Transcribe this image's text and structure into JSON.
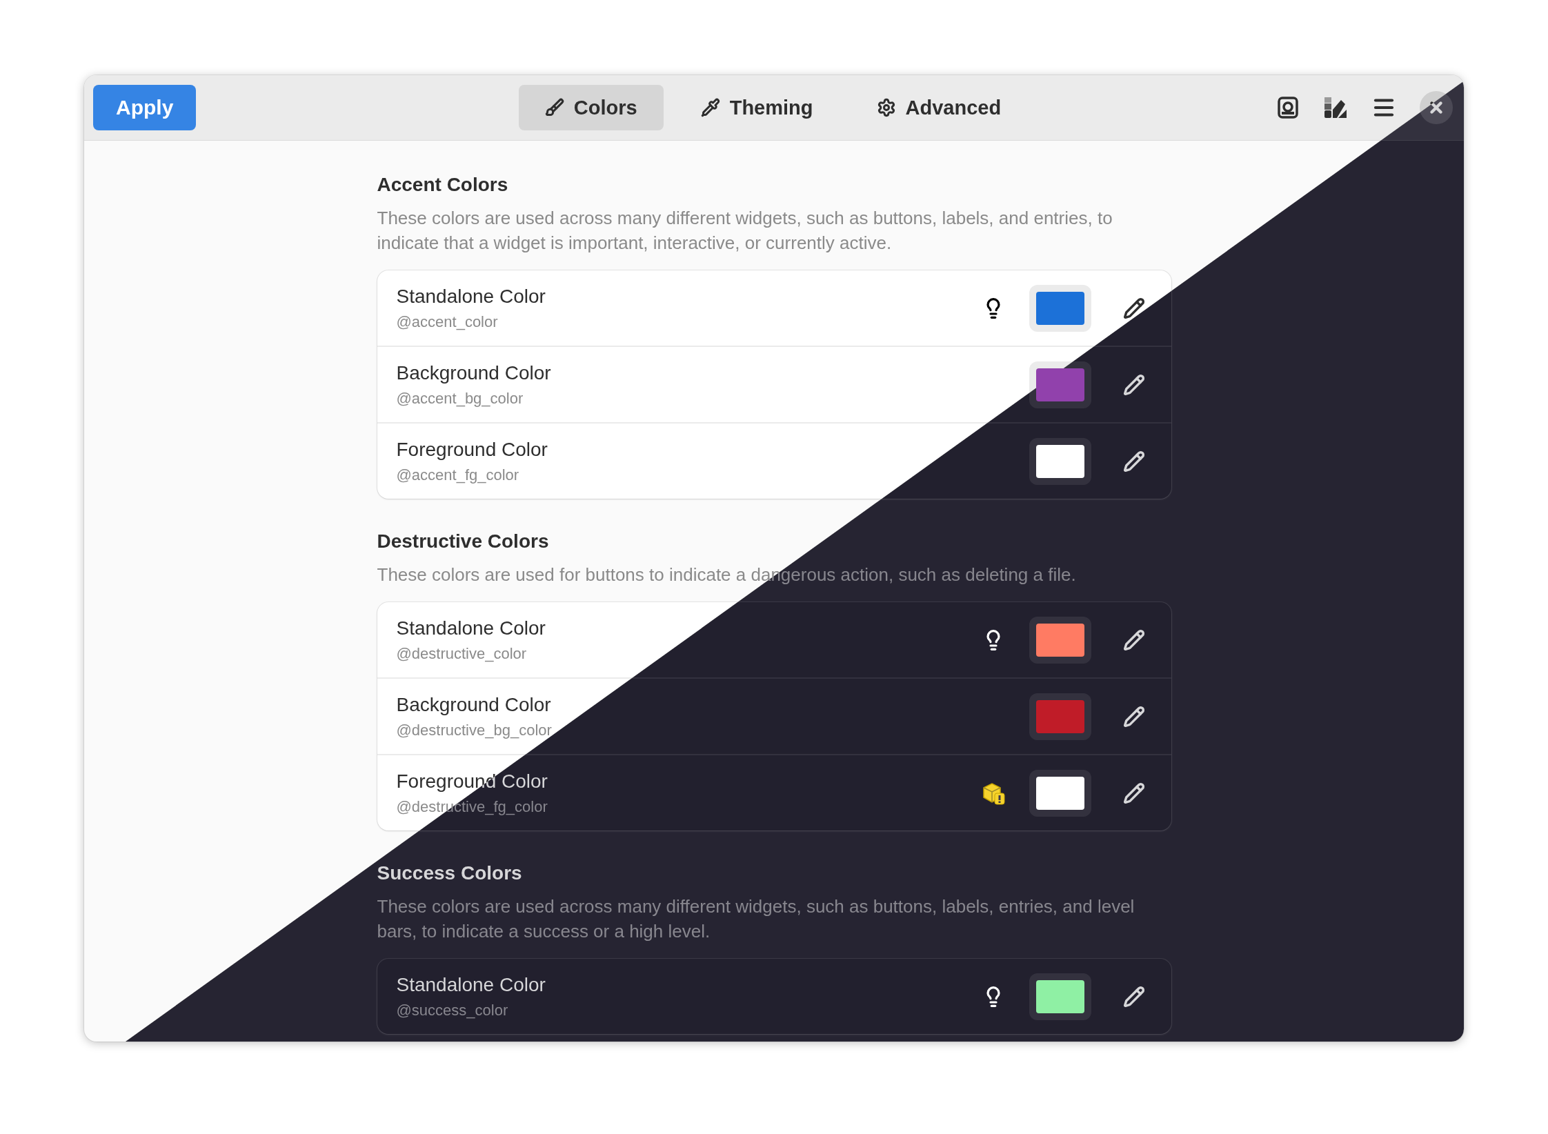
{
  "header": {
    "apply_button": "Apply",
    "tabs": [
      {
        "label": "Colors",
        "selected": true
      },
      {
        "label": "Theming",
        "selected": false
      },
      {
        "label": "Advanced",
        "selected": false
      }
    ]
  },
  "sections": [
    {
      "title": "Accent Colors",
      "description": "These colors are used across many different widgets, such as buttons, labels, and entries, to indicate that a widget is important, interactive, or currently active.",
      "rows": [
        {
          "kind": "hint",
          "name": "Standalone Color",
          "variable": "@accent_color",
          "color": "#1c71d8"
        },
        {
          "kind": "plain",
          "name": "Background Color",
          "variable": "@accent_bg_color",
          "color": "#9141ac"
        },
        {
          "kind": "plain",
          "name": "Foreground Color",
          "variable": "@accent_fg_color",
          "color": "#ffffff"
        }
      ]
    },
    {
      "title": "Destructive Colors",
      "description": "These colors are used for buttons to indicate a dangerous action, such as deleting a file.",
      "rows": [
        {
          "kind": "hint",
          "name": "Standalone Color",
          "variable": "@destructive_color",
          "color": "#ff7b63"
        },
        {
          "kind": "plain",
          "name": "Background Color",
          "variable": "@destructive_bg_color",
          "color": "#c01c28"
        },
        {
          "kind": "warning",
          "name": "Foreground Color",
          "variable": "@destructive_fg_color",
          "color": "#ffffff"
        }
      ]
    },
    {
      "title": "Success Colors",
      "description": "These colors are used across many different widgets, such as buttons, labels, entries, and level bars, to indicate a success or a high level.",
      "rows": [
        {
          "kind": "hint",
          "name": "Standalone Color",
          "variable": "@success_color",
          "color": "#8ff0a4"
        }
      ]
    }
  ]
}
